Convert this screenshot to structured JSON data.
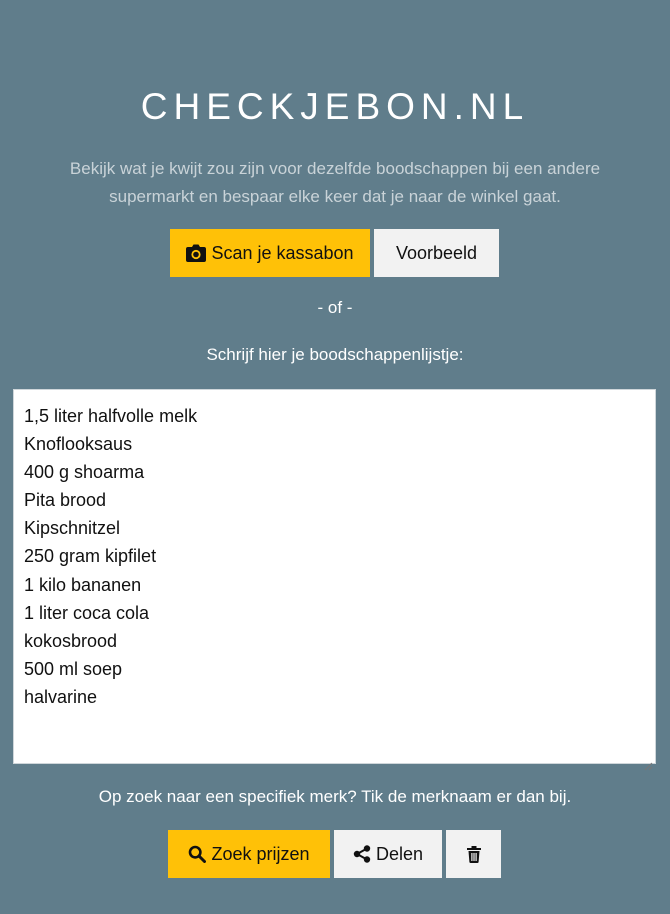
{
  "header": {
    "title": "CHECKJEBON.NL",
    "subtitle": "Bekijk wat je kwijt zou zijn voor dezelfde boodschappen bij een andere supermarkt en bespaar elke keer dat je naar de winkel gaat."
  },
  "actions": {
    "scan_label": "Scan je kassabon",
    "scan_icon": "camera-icon",
    "example_label": "Voorbeeld"
  },
  "separator": "- of -",
  "list": {
    "label": "Schrijf hier je boodschappenlijstje:",
    "items": [
      "1,5 liter halfvolle melk",
      "Knoflooksaus",
      "400 g shoarma",
      "Pita brood",
      "Kipschnitzel",
      "250 gram kipfilet",
      "1 kilo bananen",
      "1 liter coca cola",
      "kokosbrood",
      "500 ml soep",
      "halvarine"
    ]
  },
  "brand_hint": "Op zoek naar een specifiek merk? Tik de merknaam er dan bij.",
  "bottom_actions": {
    "search_label": "Zoek prijzen",
    "search_icon": "search-icon",
    "share_label": "Delen",
    "share_icon": "share-icon",
    "delete_icon": "trash-icon"
  },
  "colors": {
    "background": "#607d8b",
    "accent": "#ffc107",
    "secondary_button": "#f2f2f2",
    "subtitle_text": "#c9d3d8"
  }
}
